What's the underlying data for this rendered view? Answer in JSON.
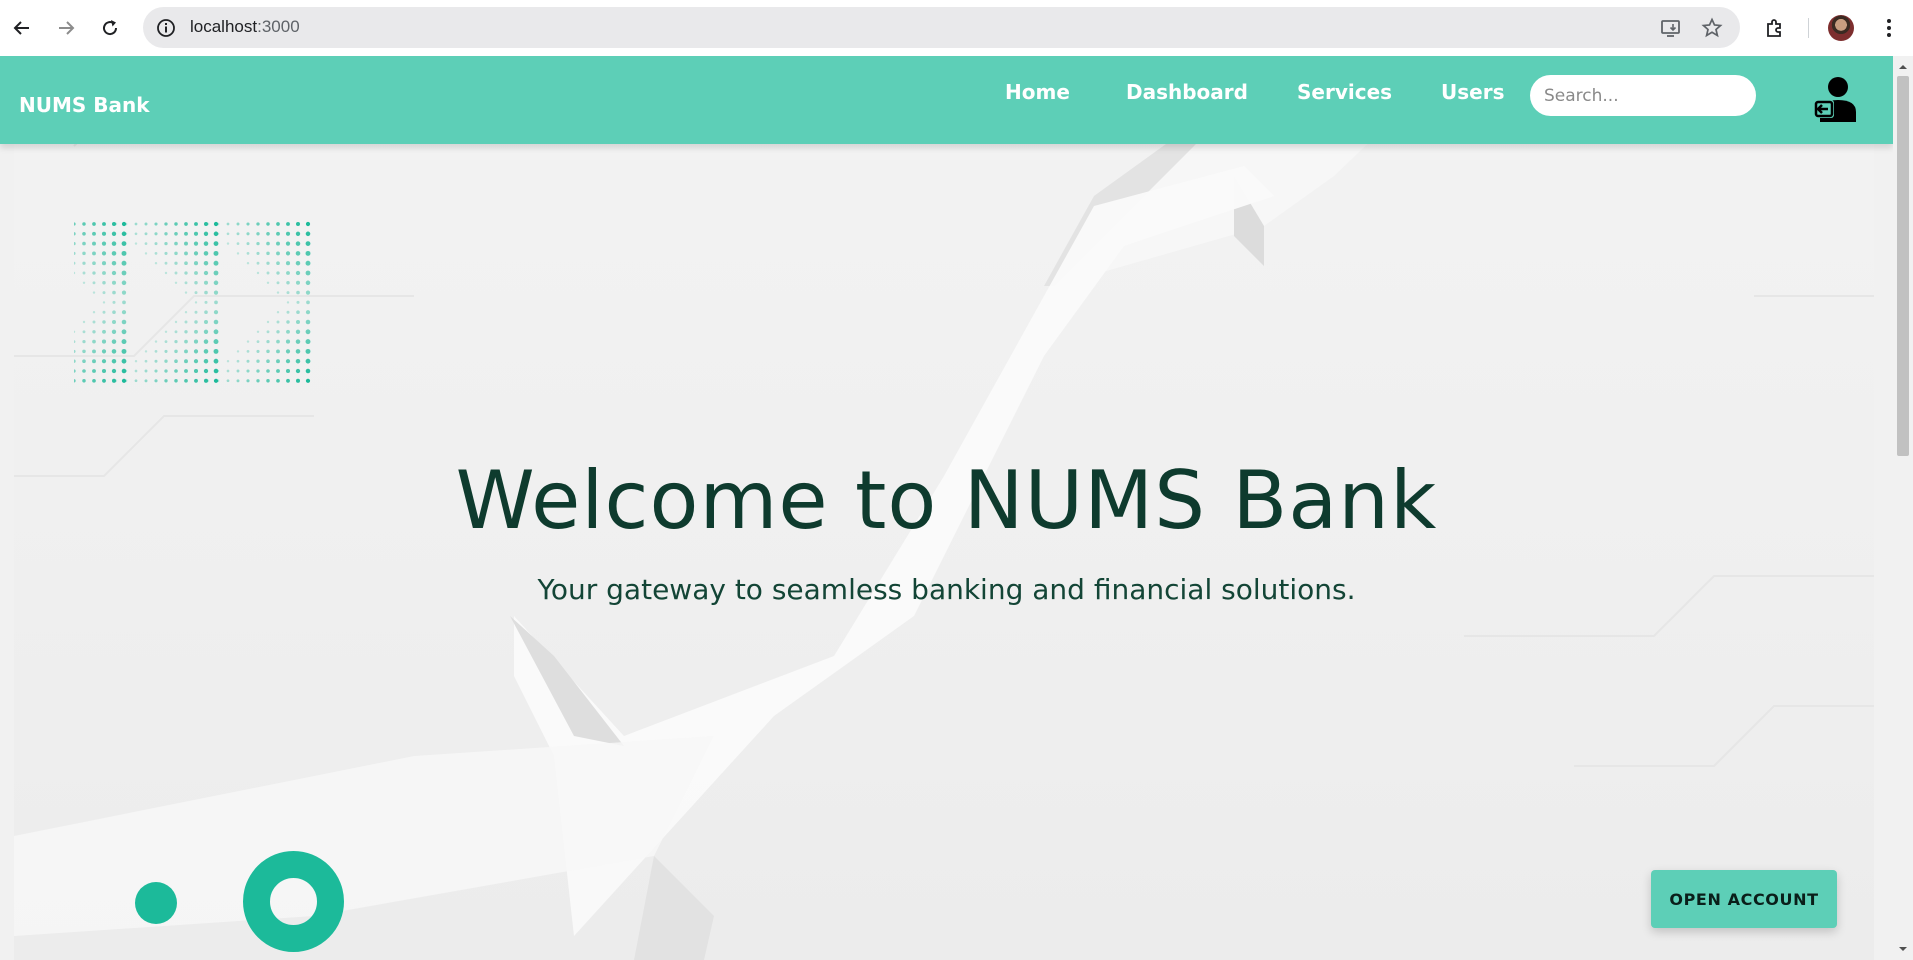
{
  "browser": {
    "url": "localhost:3000",
    "url_host": "localhost",
    "url_port": ":3000"
  },
  "navbar": {
    "brand": "NUMS Bank",
    "links": [
      {
        "label": "Home"
      },
      {
        "label": "Dashboard"
      },
      {
        "label": "Services"
      },
      {
        "label": "Users"
      }
    ],
    "search_placeholder": "Search..."
  },
  "hero": {
    "title": "Welcome to NUMS Bank",
    "subtitle": "Your gateway to seamless banking and financial solutions.",
    "cta_label": "OPEN ACCOUNT"
  },
  "colors": {
    "accent": "#5dcfb7",
    "accent_dark": "#1cba9a",
    "title_text": "#0e3b2e"
  }
}
